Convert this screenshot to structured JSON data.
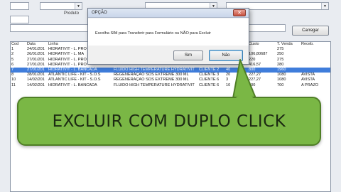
{
  "form": {
    "produto_label": "Produto",
    "carregar_label": "Carregar"
  },
  "list": {
    "columns": [
      "Cod",
      "Data",
      "Linha",
      "",
      "",
      "",
      "Custo",
      "T. Venda",
      "Receb."
    ],
    "rows": [
      [
        "1",
        "24/01/201",
        "HIDRATIVIT - L. PRO",
        "",
        "",
        "",
        "",
        "275",
        ""
      ],
      [
        "2",
        "26/01/201",
        "HIDRATIVIT - L. MA",
        "",
        "",
        "",
        "106,80687",
        "250",
        ""
      ],
      [
        "5",
        "27/01/201",
        "HIDRATIVIT - L. PRO",
        "",
        "",
        "",
        "220",
        "275",
        ""
      ],
      [
        "6",
        "27/01/201",
        "HIDRATIVIT - L. PRO",
        "",
        "",
        "",
        "416,57",
        "280",
        ""
      ],
      [
        "7",
        "27/01/201",
        "HIDRATIVIT - L. BANCADA",
        "FLUIDO HIGH TEMPERATURE HYDRATIVIT",
        "CLIENTE 2",
        "40",
        "800",
        "1960",
        ""
      ],
      [
        "8",
        "28/01/201",
        "ATLANTIC LIFE - KIT - S.O.S",
        "REGENERAÇÃO SOS EXTREME 300 ML",
        "CLIENTE 3",
        "20",
        "227,27",
        "1080",
        "AVISTA"
      ],
      [
        "10",
        "14/02/201",
        "ATLANTIC LIFE - KIT - S.O.S",
        "REGENERAÇÃO SOS EXTREME 300 ML",
        "CLIENTE 6",
        "3",
        "227,27",
        "1080",
        "AVISTA"
      ],
      [
        "11",
        "14/02/201",
        "HIDRATIVIT - L. BANCADA",
        "FLUIDO HIGH TEMPERATURE HYDRATIVIT",
        "CLIENTE 6",
        "10",
        "200",
        "700",
        "A PRAZO"
      ]
    ],
    "selected_row": 4
  },
  "dialog": {
    "title": "OPÇÃO",
    "close_glyph": "✕",
    "message": "Escolha SIM para Transferir para Formulário ou NÃO para Excluir",
    "yes_label": "Sim",
    "no_label": "Não"
  },
  "callout": {
    "text": "EXCLUIR COM DUPLO CLICK"
  },
  "colors": {
    "selection": "#3f7ddb",
    "callout_fill": "#7ab745",
    "dialog_close": "#c8503d"
  }
}
